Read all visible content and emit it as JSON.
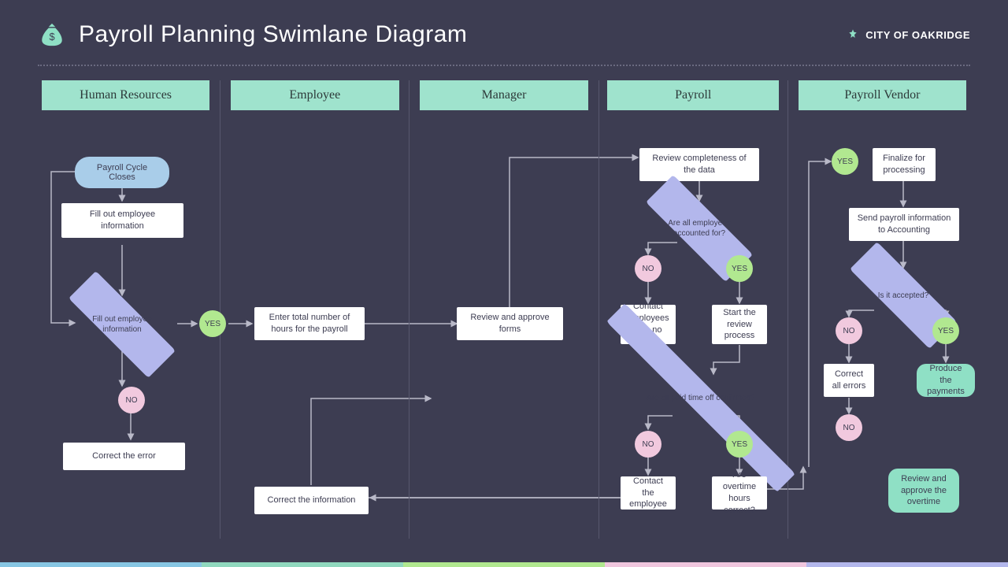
{
  "title": "Payroll Planning Swimlane Diagram",
  "brand": "CITY OF OAKRIDGE",
  "lanes": [
    "Human Resources",
    "Employee",
    "Manager",
    "Payroll",
    "Payroll Vendor"
  ],
  "hr": {
    "start": "Payroll Cycle Closes",
    "fillInfo": "Fill out employee information",
    "decision": "Fill out employee information",
    "yes": "YES",
    "no": "NO",
    "correct": "Correct the error"
  },
  "emp": {
    "enterHours": "Enter total number of hours for the payroll",
    "correctInfo": "Correct the information"
  },
  "mgr": {
    "review": "Review and approve forms"
  },
  "pay": {
    "reviewData": "Review completeness of the data",
    "allAccounted": "Are all employees accounted for?",
    "no": "NO",
    "yes": "YES",
    "contactNoReport": "Contact employees with no report",
    "startReview": "Start the review process",
    "ptoConfirmed": "Are all paid time off confirmed?",
    "contactEmp": "Contact the employee",
    "overtime": "Are overtime hours correct?"
  },
  "ven": {
    "yes": "YES",
    "finalize": "Finalize for processing",
    "sendAcct": "Send payroll information to Accounting",
    "accepted": "Is it accepted?",
    "no": "NO",
    "correctErrors": "Correct all errors",
    "produce": "Produce the payments",
    "reviewOT": "Review  and approve the overtime"
  }
}
